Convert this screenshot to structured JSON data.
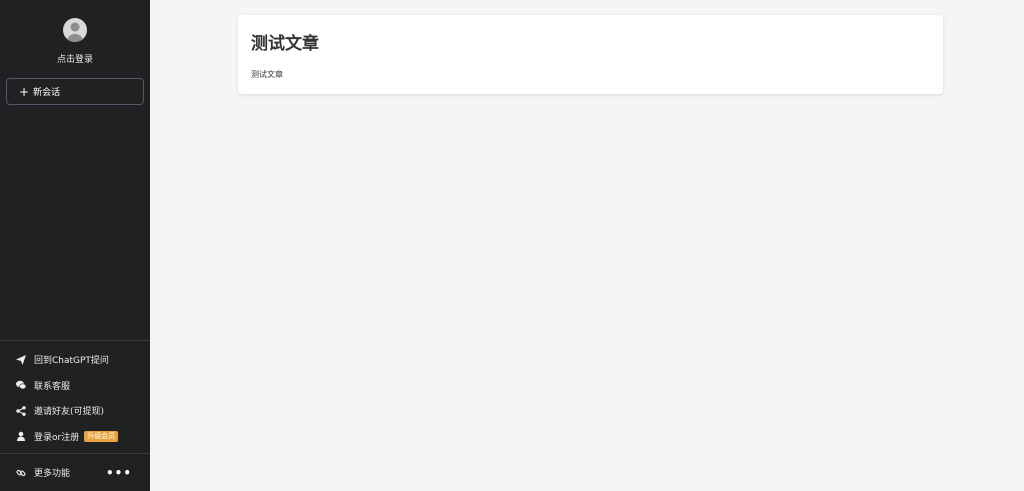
{
  "sidebar": {
    "login_text": "点击登录",
    "new_chat_label": "新会话",
    "menu": [
      {
        "label": "回到ChatGPT提问",
        "icon": "paper-plane-icon"
      },
      {
        "label": "联系客服",
        "icon": "wechat-icon"
      },
      {
        "label": "邀请好友(可提现)",
        "icon": "share-icon"
      },
      {
        "label": "登录or注册",
        "icon": "user-icon",
        "badge": "升级会员"
      }
    ],
    "more_label": "更多功能",
    "more_dots": "•••"
  },
  "article": {
    "title": "测试文章",
    "body": "测试文章"
  },
  "colors": {
    "sidebar_bg": "#202123",
    "page_bg": "#f5f5f5",
    "badge_bg": "#e8a33d"
  }
}
